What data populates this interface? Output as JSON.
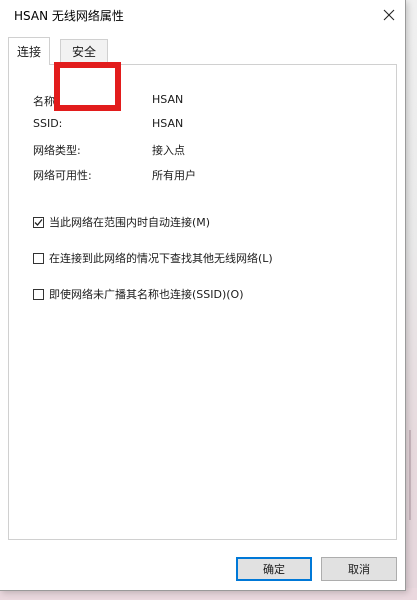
{
  "window": {
    "title": "HSAN 无线网络属性"
  },
  "tabs": [
    {
      "label": "连接"
    },
    {
      "label": "安全"
    }
  ],
  "properties": [
    {
      "label": "名称:",
      "value": "HSAN"
    },
    {
      "label": "SSID:",
      "value": "HSAN"
    },
    {
      "label": "网络类型:",
      "value": "接入点"
    },
    {
      "label": "网络可用性:",
      "value": "所有用户"
    }
  ],
  "options": [
    {
      "label": "当此网络在范围内时自动连接(M)",
      "checked": true
    },
    {
      "label": "在连接到此网络的情况下查找其他无线网络(L)",
      "checked": false
    },
    {
      "label": "即使网络未广播其名称也连接(SSID)(O)",
      "checked": false
    }
  ],
  "buttons": {
    "ok": "确定",
    "cancel": "取消"
  },
  "colors": {
    "highlight": "#e21c1c",
    "accent": "#0078d7"
  }
}
